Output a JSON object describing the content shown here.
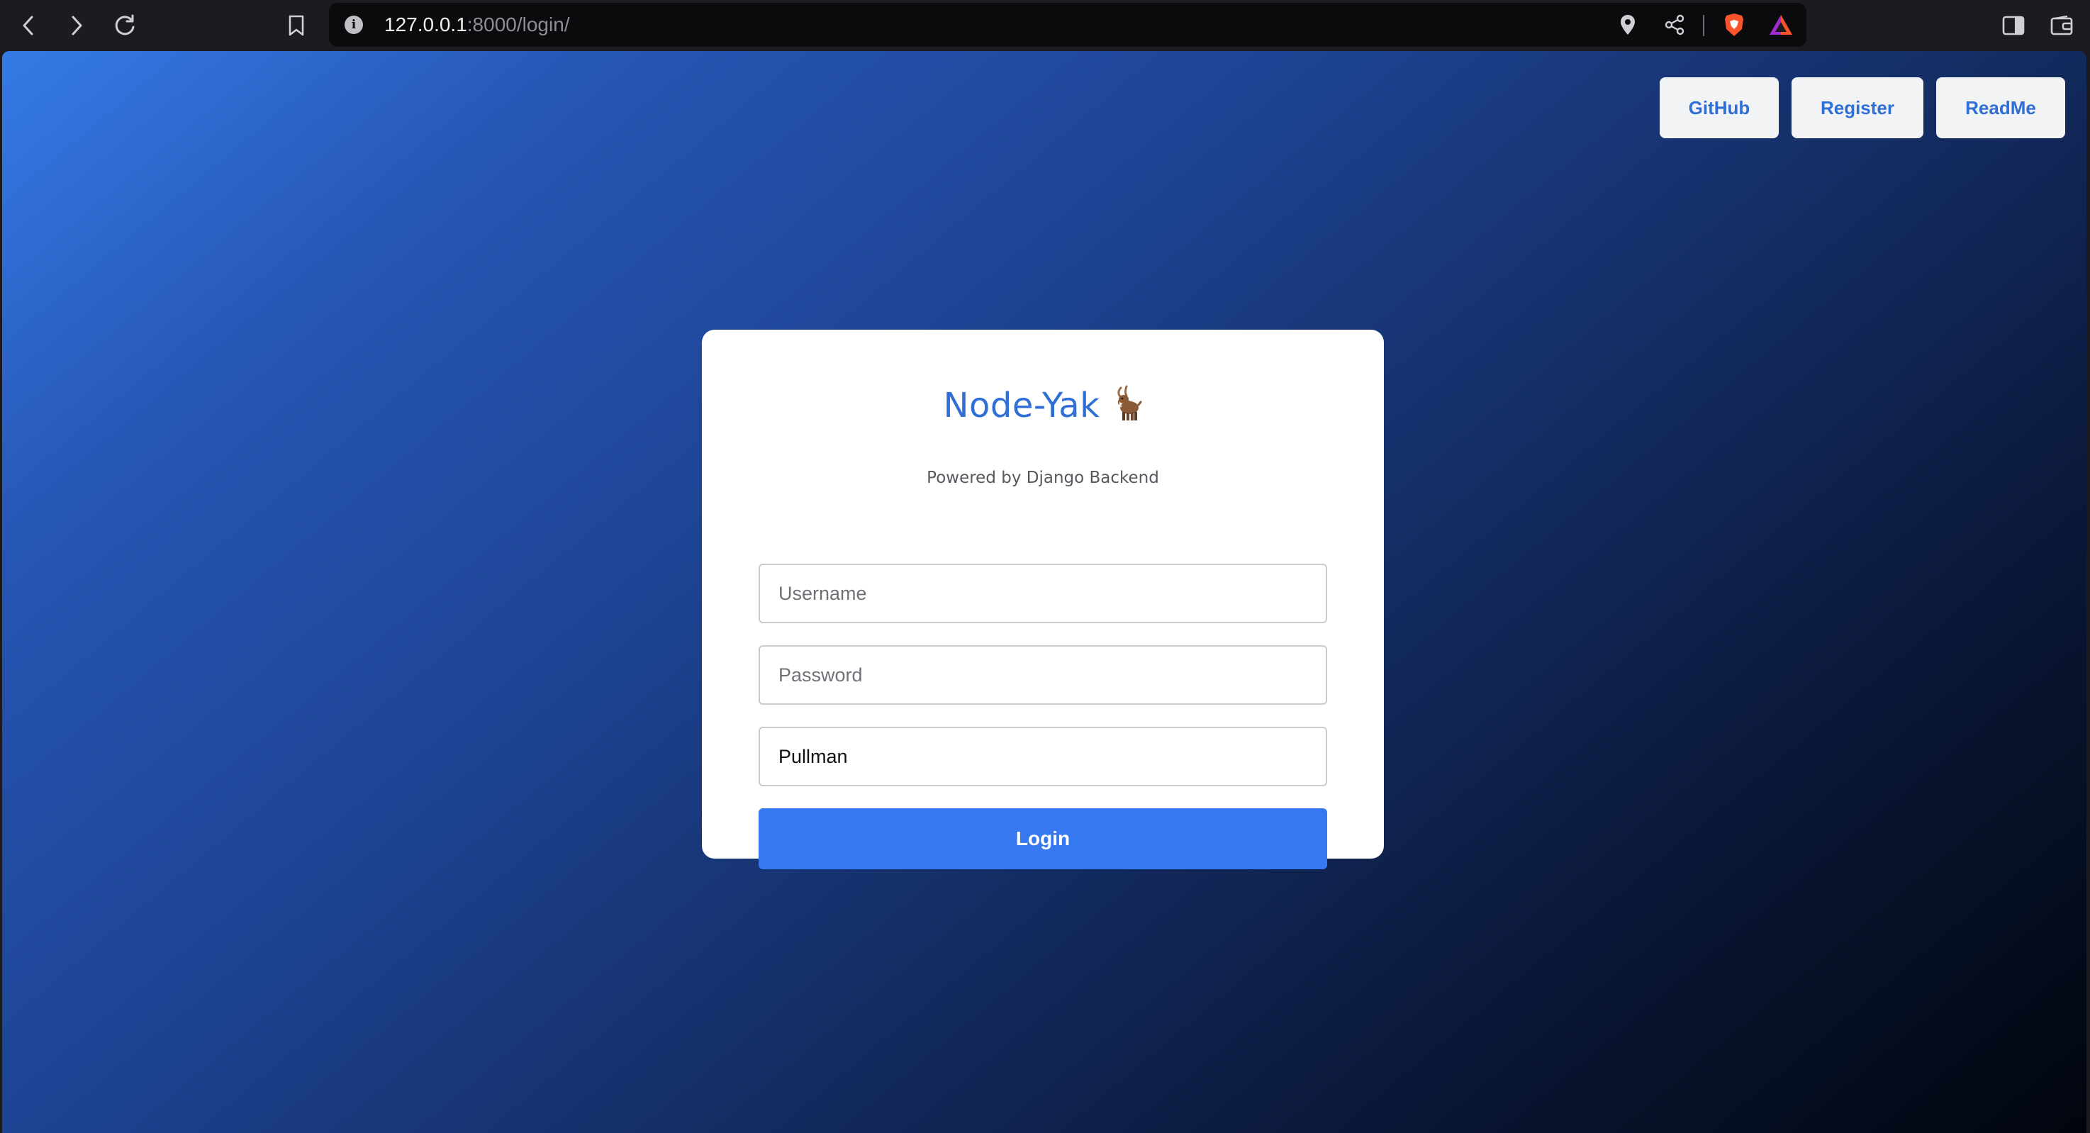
{
  "browser": {
    "url_host": "127.0.0.1",
    "url_rest": ":8000/login/",
    "icons": {
      "back": "back-arrow-icon",
      "forward": "forward-arrow-icon",
      "reload": "reload-icon",
      "bookmark": "bookmark-icon",
      "info": "i",
      "location": "location-pin-icon",
      "share": "share-icon",
      "brave": "brave-shield-icon",
      "rewards": "brave-rewards-icon",
      "sidebar": "sidebar-icon",
      "wallet": "wallet-icon"
    },
    "colors": {
      "toolbar": "#1c1c20",
      "urlbar": "#0b0b0d",
      "brave_orange": "#fb542b"
    }
  },
  "nav": {
    "github": "GitHub",
    "register": "Register",
    "readme": "ReadMe"
  },
  "card": {
    "title": "Node-Yak",
    "title_emoji": "goat-icon",
    "subtitle": "Powered by Django Backend",
    "username_placeholder": "Username",
    "password_placeholder": "Password",
    "third_field_value": "Pullman",
    "login_label": "Login"
  },
  "colors": {
    "accent": "#3578f0",
    "link_blue": "#2f6fd6",
    "gradient_start": "#357ae6",
    "gradient_end": "#01050d"
  }
}
